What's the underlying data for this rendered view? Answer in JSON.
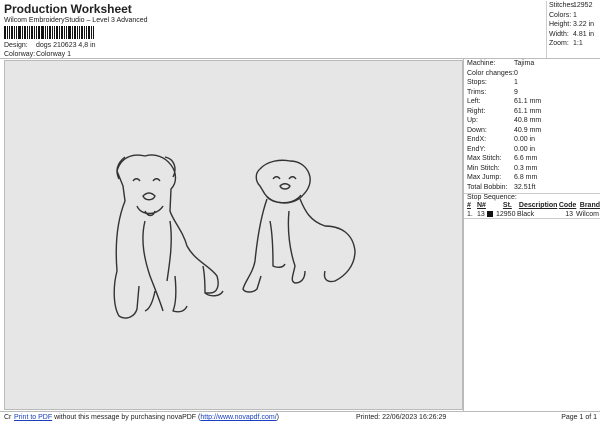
{
  "header": {
    "title": "Production Worksheet",
    "subtitle": "Wilcom EmbroideryStudio – Level 3 Advanced",
    "design_label": "Design:",
    "design_value": "dogs 210623 4,8 in",
    "colorway_label": "Colorway:",
    "colorway_value": "Colorway 1"
  },
  "stats": [
    {
      "k": "Stitches:",
      "v": "12952"
    },
    {
      "k": "Colors:",
      "v": "1"
    },
    {
      "k": "Height:",
      "v": "3.22 in"
    },
    {
      "k": "Width:",
      "v": "4.81 in"
    },
    {
      "k": "Zoom:",
      "v": "1:1"
    }
  ],
  "details": [
    {
      "k": "Machine:",
      "v": "Tajima"
    },
    {
      "k": "Color changes:",
      "v": "0"
    },
    {
      "k": "Stops:",
      "v": "1"
    },
    {
      "k": "Trims:",
      "v": "9"
    },
    {
      "k": "Left:",
      "v": "61.1 mm"
    },
    {
      "k": "Right:",
      "v": "61.1 mm"
    },
    {
      "k": "Up:",
      "v": "40.8 mm"
    },
    {
      "k": "Down:",
      "v": "40.9 mm"
    },
    {
      "k": "EndX:",
      "v": "0.00 in"
    },
    {
      "k": "EndY:",
      "v": "0.00 in"
    },
    {
      "k": "Max Stitch:",
      "v": "6.6 mm"
    },
    {
      "k": "Min Stitch:",
      "v": "0.3 mm"
    },
    {
      "k": "Max Jump:",
      "v": "6.8 mm"
    },
    {
      "k": "Total Bobbin:",
      "v": "32.51ft"
    }
  ],
  "stop_sequence": {
    "label": "Stop Sequence:",
    "headers": [
      "#",
      "N#",
      "St.",
      "Description",
      "Code",
      "Brand"
    ],
    "rows": [
      {
        "n": "1.",
        "needle": "13",
        "st": "12950",
        "desc": "Black",
        "code": "13",
        "brand": "Wilcom",
        "color": "#111111"
      }
    ]
  },
  "footer": {
    "prefix": "Cr",
    "link": "Print to PDF",
    "text": " without this message by purchasing novaPDF (",
    "url": "http://www.novapdf.com/",
    "close": ")",
    "printed": "Printed: 22/06/2023 16:26:29",
    "page": "Page 1 of 1"
  }
}
